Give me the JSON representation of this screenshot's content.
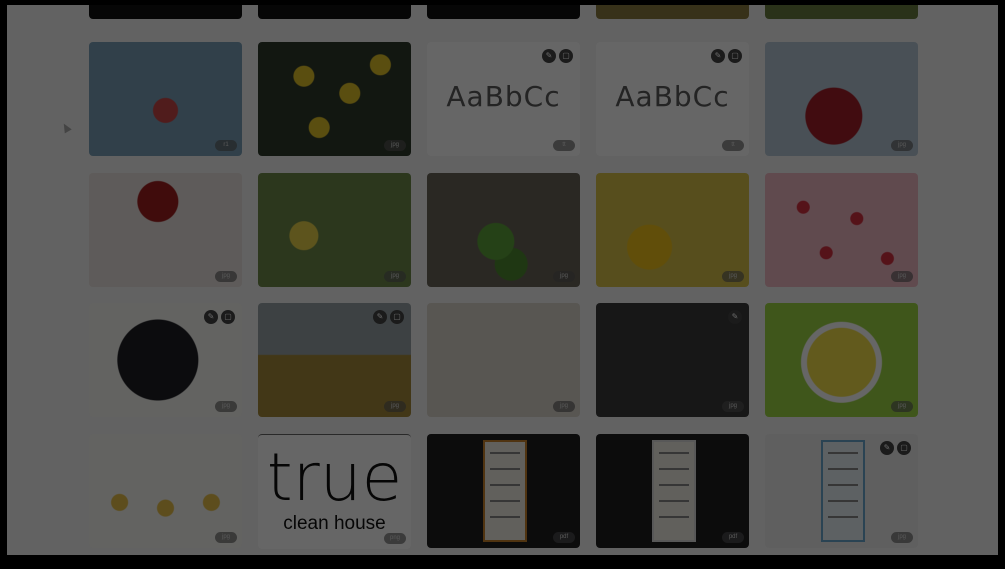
{
  "gallery": {
    "rows": [
      [
        {
          "name": "pomegranate-box-image",
          "badge": "r1",
          "bg": "#7aa0b8"
        },
        {
          "name": "lemons-image",
          "badge": "jpg",
          "bg": "#2f3a2c"
        },
        {
          "name": "font-sample-1",
          "type": "text",
          "text": "AaBbCc",
          "badge": "tt"
        },
        {
          "name": "font-sample-2",
          "type": "text",
          "text": "AaBbCc",
          "badge": "tt"
        },
        {
          "name": "pomegranate-hands-image",
          "badge": "jpg",
          "bg": "#b7c8d6"
        }
      ],
      [
        {
          "name": "pomegranate-seeds-image",
          "badge": "jpg",
          "bg": "#eae4e0"
        },
        {
          "name": "lemon-tree-image",
          "badge": "jpg",
          "bg": "#6e8a4a"
        },
        {
          "name": "limes-image",
          "badge": "jpg",
          "bg": "#6a6458"
        },
        {
          "name": "sunflowers-vase-image",
          "badge": "jpg",
          "bg": "#d9c24a"
        },
        {
          "name": "raspberries-image",
          "badge": "jpg",
          "bg": "#f0b8c4"
        }
      ],
      [
        {
          "name": "blueberries-image",
          "badge": "jpg",
          "bg": "#2a2a30"
        },
        {
          "name": "sunflower-field-image",
          "badge": "jpg",
          "bg": "#a68a3a"
        },
        {
          "name": "hand-soap-image",
          "badge": "jpg",
          "bg": "#ddd6cc"
        },
        {
          "name": "woman-kitchen-image",
          "badge": "jpg",
          "bg": "#3a3a3a"
        },
        {
          "name": "lemon-illustration",
          "badge": "jpg",
          "bg": "#9ed645"
        }
      ],
      [
        {
          "name": "spray-bottles-image",
          "badge": "jpg",
          "bg": "#f7f7f2"
        },
        {
          "name": "true-logo",
          "type": "logo",
          "big": "true",
          "small": "clean house",
          "badge": "png"
        },
        {
          "name": "doc-orange",
          "type": "doc",
          "badge": "pdf"
        },
        {
          "name": "doc-white",
          "type": "doc",
          "badge": "pdf"
        },
        {
          "name": "doc-blue",
          "type": "doc",
          "badge": "jpg"
        }
      ]
    ]
  }
}
